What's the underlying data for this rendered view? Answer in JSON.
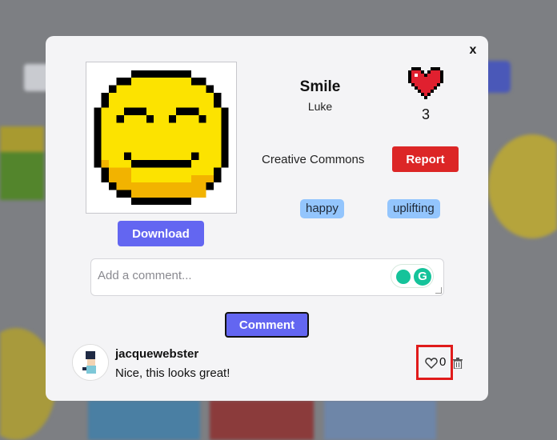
{
  "modal": {
    "close_label": "x",
    "artwork": {
      "title": "Smile",
      "author": "Luke",
      "likes": "3",
      "license": "Creative Commons",
      "tags": [
        "happy",
        "uplifting"
      ]
    },
    "buttons": {
      "download": "Download",
      "report": "Report",
      "comment": "Comment"
    },
    "comment_input": {
      "placeholder": "Add a comment..."
    },
    "comments": [
      {
        "user": "jacquewebster",
        "text": "Nice, this looks great!",
        "likes": "0"
      }
    ]
  },
  "colors": {
    "accent": "#6366f1",
    "danger": "#dc2626",
    "tag": "#93c5fd",
    "smiley_yellow": "#fce300",
    "like_red": "#e0202f",
    "highlight_box": "#e01b1b"
  },
  "icons": [
    "close-icon",
    "heart-icon",
    "heart-outline-icon",
    "trash-icon",
    "grammarly-icon",
    "bulb-icon"
  ]
}
